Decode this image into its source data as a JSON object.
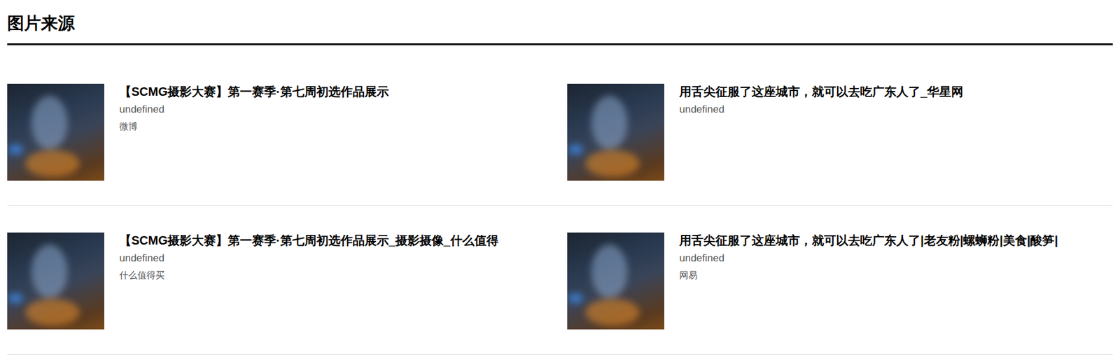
{
  "section": {
    "title": "图片来源"
  },
  "items": [
    {
      "title": "【SCMG摄影大赛】第一赛季·第七周初选作品展示",
      "subtitle": "undefined",
      "source": "微博"
    },
    {
      "title": "用舌尖征服了这座城市，就可以去吃广东人了_华星网",
      "subtitle": "undefined"
    },
    {
      "title": "【SCMG摄影大赛】第一赛季·第七周初选作品展示_摄影摄像_什么值得",
      "subtitle": "undefined",
      "source": "什么值得买"
    },
    {
      "title": "用舌尖征服了这座城市，就可以去吃广东人了|老友粉|螺蛳粉|美食|酸笋|",
      "subtitle": "undefined",
      "source": "网易"
    }
  ]
}
